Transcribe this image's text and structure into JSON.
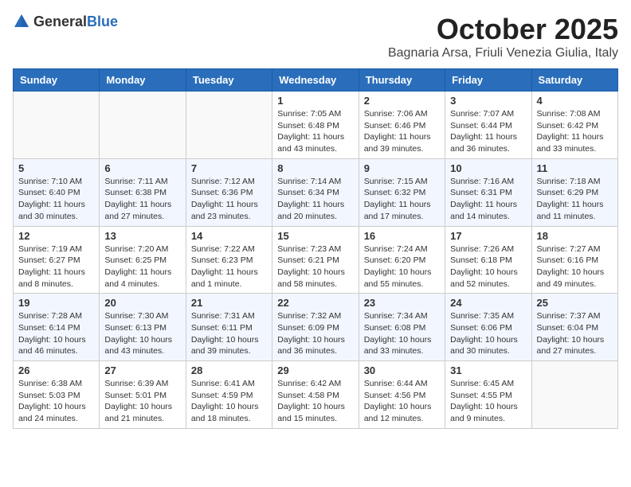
{
  "logo": {
    "general": "General",
    "blue": "Blue"
  },
  "title": "October 2025",
  "subtitle": "Bagnaria Arsa, Friuli Venezia Giulia, Italy",
  "days_header": [
    "Sunday",
    "Monday",
    "Tuesday",
    "Wednesday",
    "Thursday",
    "Friday",
    "Saturday"
  ],
  "weeks": [
    {
      "days": [
        {
          "num": "",
          "info": ""
        },
        {
          "num": "",
          "info": ""
        },
        {
          "num": "",
          "info": ""
        },
        {
          "num": "1",
          "info": "Sunrise: 7:05 AM\nSunset: 6:48 PM\nDaylight: 11 hours and 43 minutes."
        },
        {
          "num": "2",
          "info": "Sunrise: 7:06 AM\nSunset: 6:46 PM\nDaylight: 11 hours and 39 minutes."
        },
        {
          "num": "3",
          "info": "Sunrise: 7:07 AM\nSunset: 6:44 PM\nDaylight: 11 hours and 36 minutes."
        },
        {
          "num": "4",
          "info": "Sunrise: 7:08 AM\nSunset: 6:42 PM\nDaylight: 11 hours and 33 minutes."
        }
      ]
    },
    {
      "days": [
        {
          "num": "5",
          "info": "Sunrise: 7:10 AM\nSunset: 6:40 PM\nDaylight: 11 hours and 30 minutes."
        },
        {
          "num": "6",
          "info": "Sunrise: 7:11 AM\nSunset: 6:38 PM\nDaylight: 11 hours and 27 minutes."
        },
        {
          "num": "7",
          "info": "Sunrise: 7:12 AM\nSunset: 6:36 PM\nDaylight: 11 hours and 23 minutes."
        },
        {
          "num": "8",
          "info": "Sunrise: 7:14 AM\nSunset: 6:34 PM\nDaylight: 11 hours and 20 minutes."
        },
        {
          "num": "9",
          "info": "Sunrise: 7:15 AM\nSunset: 6:32 PM\nDaylight: 11 hours and 17 minutes."
        },
        {
          "num": "10",
          "info": "Sunrise: 7:16 AM\nSunset: 6:31 PM\nDaylight: 11 hours and 14 minutes."
        },
        {
          "num": "11",
          "info": "Sunrise: 7:18 AM\nSunset: 6:29 PM\nDaylight: 11 hours and 11 minutes."
        }
      ]
    },
    {
      "days": [
        {
          "num": "12",
          "info": "Sunrise: 7:19 AM\nSunset: 6:27 PM\nDaylight: 11 hours and 8 minutes."
        },
        {
          "num": "13",
          "info": "Sunrise: 7:20 AM\nSunset: 6:25 PM\nDaylight: 11 hours and 4 minutes."
        },
        {
          "num": "14",
          "info": "Sunrise: 7:22 AM\nSunset: 6:23 PM\nDaylight: 11 hours and 1 minute."
        },
        {
          "num": "15",
          "info": "Sunrise: 7:23 AM\nSunset: 6:21 PM\nDaylight: 10 hours and 58 minutes."
        },
        {
          "num": "16",
          "info": "Sunrise: 7:24 AM\nSunset: 6:20 PM\nDaylight: 10 hours and 55 minutes."
        },
        {
          "num": "17",
          "info": "Sunrise: 7:26 AM\nSunset: 6:18 PM\nDaylight: 10 hours and 52 minutes."
        },
        {
          "num": "18",
          "info": "Sunrise: 7:27 AM\nSunset: 6:16 PM\nDaylight: 10 hours and 49 minutes."
        }
      ]
    },
    {
      "days": [
        {
          "num": "19",
          "info": "Sunrise: 7:28 AM\nSunset: 6:14 PM\nDaylight: 10 hours and 46 minutes."
        },
        {
          "num": "20",
          "info": "Sunrise: 7:30 AM\nSunset: 6:13 PM\nDaylight: 10 hours and 43 minutes."
        },
        {
          "num": "21",
          "info": "Sunrise: 7:31 AM\nSunset: 6:11 PM\nDaylight: 10 hours and 39 minutes."
        },
        {
          "num": "22",
          "info": "Sunrise: 7:32 AM\nSunset: 6:09 PM\nDaylight: 10 hours and 36 minutes."
        },
        {
          "num": "23",
          "info": "Sunrise: 7:34 AM\nSunset: 6:08 PM\nDaylight: 10 hours and 33 minutes."
        },
        {
          "num": "24",
          "info": "Sunrise: 7:35 AM\nSunset: 6:06 PM\nDaylight: 10 hours and 30 minutes."
        },
        {
          "num": "25",
          "info": "Sunrise: 7:37 AM\nSunset: 6:04 PM\nDaylight: 10 hours and 27 minutes."
        }
      ]
    },
    {
      "days": [
        {
          "num": "26",
          "info": "Sunrise: 6:38 AM\nSunset: 5:03 PM\nDaylight: 10 hours and 24 minutes."
        },
        {
          "num": "27",
          "info": "Sunrise: 6:39 AM\nSunset: 5:01 PM\nDaylight: 10 hours and 21 minutes."
        },
        {
          "num": "28",
          "info": "Sunrise: 6:41 AM\nSunset: 4:59 PM\nDaylight: 10 hours and 18 minutes."
        },
        {
          "num": "29",
          "info": "Sunrise: 6:42 AM\nSunset: 4:58 PM\nDaylight: 10 hours and 15 minutes."
        },
        {
          "num": "30",
          "info": "Sunrise: 6:44 AM\nSunset: 4:56 PM\nDaylight: 10 hours and 12 minutes."
        },
        {
          "num": "31",
          "info": "Sunrise: 6:45 AM\nSunset: 4:55 PM\nDaylight: 10 hours and 9 minutes."
        },
        {
          "num": "",
          "info": ""
        }
      ]
    }
  ]
}
